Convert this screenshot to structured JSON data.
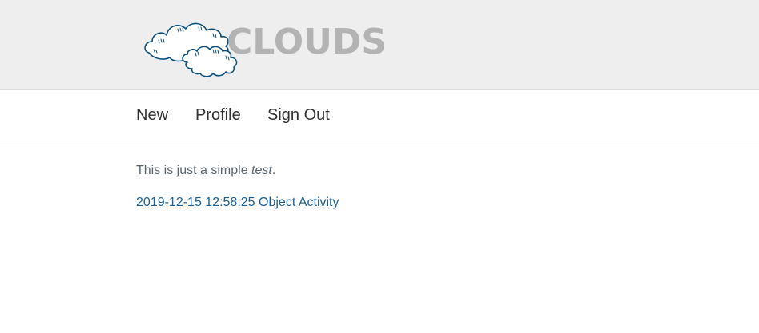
{
  "brand": {
    "logo_text": "CLOUDS",
    "logo_icon": "cloud-icon",
    "text_color": "#b3b3b3",
    "cloud_stroke": "#0d4f7a"
  },
  "nav": {
    "items": [
      {
        "label": "New"
      },
      {
        "label": "Profile"
      },
      {
        "label": "Sign Out"
      }
    ]
  },
  "main": {
    "intro_prefix": "This is just a simple ",
    "intro_emphasis": "test",
    "intro_suffix": ".",
    "activity_link": "2019-12-15 12:58:25 Object Activity",
    "link_color": "#1a5f96"
  }
}
